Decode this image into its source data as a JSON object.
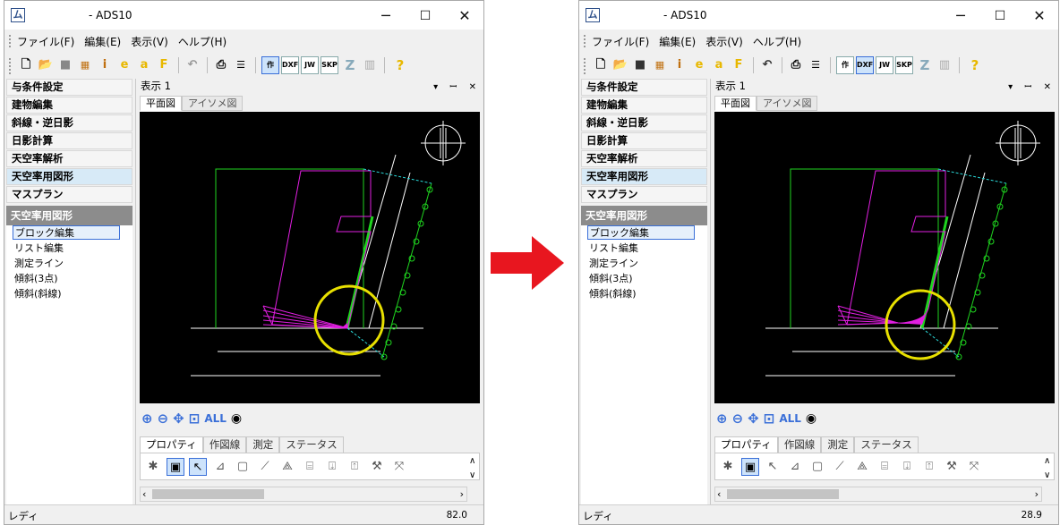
{
  "arrow": {
    "color": "#e8161f"
  },
  "windows": [
    {
      "title": "- ADS10",
      "menu": [
        "ファイル(F)",
        "編集(E)",
        "表示(V)",
        "ヘルプ(H)"
      ],
      "toolbar_labels": {
        "saku": "作",
        "dxf": "DXF",
        "jw": "JW",
        "skp": "SKP",
        "z": "Z"
      },
      "left_nav": [
        "与条件設定",
        "建物編集",
        "斜線・逆日影",
        "日影計算",
        "天空率解析",
        "天空率用図形",
        "マスプラン"
      ],
      "section_header": "天空率用図形",
      "sub_items": [
        "ブロック編集",
        "リスト編集",
        "測定ライン",
        "傾斜(3点)",
        "傾斜(斜線)"
      ],
      "view_title": "表示 1",
      "view_tabs": [
        "平面図",
        "アイソメ図"
      ],
      "zoom_all": "ALL",
      "prop_tabs": [
        "プロパティ",
        "作図線",
        "測定",
        "ステータス"
      ],
      "status_left": "レディ",
      "status_right": "82.0",
      "annotation_color": "#e8e000"
    },
    {
      "title": "- ADS10",
      "menu": [
        "ファイル(F)",
        "編集(E)",
        "表示(V)",
        "ヘルプ(H)"
      ],
      "toolbar_labels": {
        "saku": "作",
        "dxf": "DXF",
        "jw": "JW",
        "skp": "SKP",
        "z": "Z"
      },
      "left_nav": [
        "与条件設定",
        "建物編集",
        "斜線・逆日影",
        "日影計算",
        "天空率解析",
        "天空率用図形",
        "マスプラン"
      ],
      "section_header": "天空率用図形",
      "sub_items": [
        "ブロック編集",
        "リスト編集",
        "測定ライン",
        "傾斜(3点)",
        "傾斜(斜線)"
      ],
      "view_title": "表示 1",
      "view_tabs": [
        "平面図",
        "アイソメ図"
      ],
      "zoom_all": "ALL",
      "prop_tabs": [
        "プロパティ",
        "作図線",
        "測定",
        "ステータス"
      ],
      "status_left": "レディ",
      "status_right": "28.9",
      "annotation_color": "#e8e000"
    }
  ]
}
